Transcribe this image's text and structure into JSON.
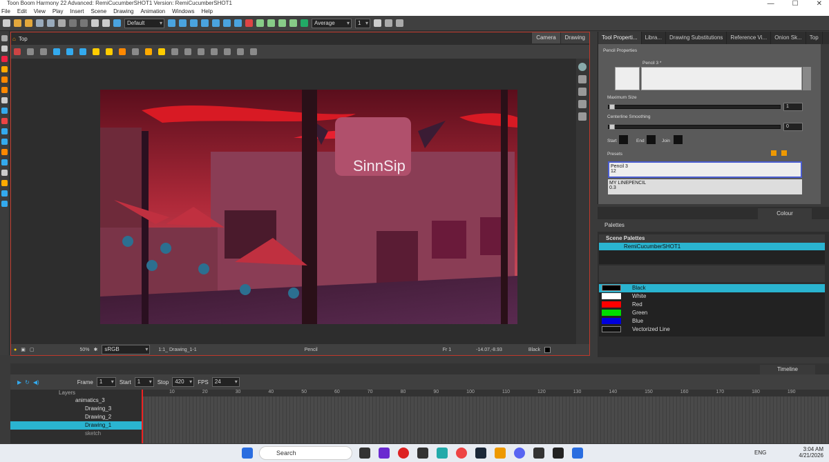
{
  "app": {
    "title": "Toon Boom Harmony 22 Advanced: RemiCucumberSHOT1 Version: RemiCucumberSHOT1",
    "minimize": "—",
    "maximize": "☐",
    "close": "✕"
  },
  "menu": [
    "File",
    "Edit",
    "View",
    "Play",
    "Insert",
    "Scene",
    "Drawing",
    "Animation",
    "Windows",
    "Help"
  ],
  "toolbar": {
    "workspace": "Default",
    "interp": "Average",
    "interp_value": "1"
  },
  "view": {
    "tabs": [
      "Camera",
      "Drawing"
    ],
    "breadcrumb": "Top",
    "colorspace": "sRGB",
    "zoom": "50%",
    "drawing_label": "1:1_ Drawing_1-1",
    "tool": "Pencil",
    "frame": "Fr 1",
    "coords": "-14.07,-8.93",
    "color": "Black",
    "sign_text": "SinnSip"
  },
  "toolprops": {
    "tabs": [
      "Tool Properti...",
      "Libra...",
      "Drawing Substitutions",
      "Reference Vi...",
      "Onion Sk...",
      "Top"
    ],
    "section": "Pencil Properties",
    "pencil_name": "Pencil 3 *",
    "max_size_label": "Maximum Size",
    "max_size": "1",
    "smoothing_label": "Centerline Smoothing",
    "smoothing": "0",
    "start": "Start",
    "end": "End",
    "join": "Join",
    "presets_label": "Presets",
    "presets": [
      {
        "name": "Pencil 3",
        "size": "12"
      },
      {
        "name": "MY LINEPENCIL",
        "size": "0.3"
      }
    ]
  },
  "colour": {
    "title": "Colour",
    "palettes_label": "Palettes",
    "scene_palettes": "Scene Palettes",
    "palette": "RemiCucumberSHOT1",
    "swatches": [
      {
        "name": "Black",
        "hex": "#000000"
      },
      {
        "name": "White",
        "hex": "#ffffff"
      },
      {
        "name": "Red",
        "hex": "#ff0000"
      },
      {
        "name": "Green",
        "hex": "#00dd00"
      },
      {
        "name": "Blue",
        "hex": "#0000dd"
      },
      {
        "name": "Vectorized Line",
        "hex": "#111111"
      }
    ]
  },
  "timeline": {
    "title": "Timeline",
    "frame_label": "Frame",
    "frame": "1",
    "start_label": "Start",
    "start": "1",
    "stop_label": "Stop",
    "stop": "420",
    "fps_label": "FPS",
    "fps": "24",
    "layers_label": "Layers",
    "layers": [
      "animatics_3",
      "Drawing_3",
      "Drawing_2",
      "Drawing_1",
      "sketch"
    ],
    "ruler": [
      "10",
      "20",
      "30",
      "40",
      "50",
      "60",
      "70",
      "80",
      "90",
      "100",
      "110",
      "120",
      "130",
      "140",
      "150",
      "160",
      "170",
      "180",
      "190"
    ]
  },
  "taskbar": {
    "search": "Search",
    "lang": "ENG",
    "time": "3:04 AM",
    "date": "4/21/2026"
  }
}
